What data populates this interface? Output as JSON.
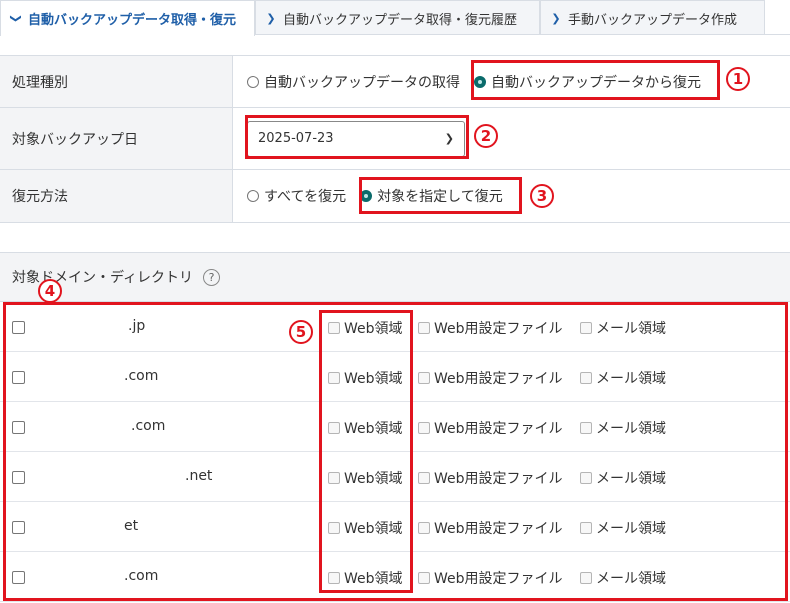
{
  "tabs": [
    {
      "label": "自動バックアップデータ取得・復元",
      "active": true
    },
    {
      "label": "自動バックアップデータ取得・復元履歴",
      "active": false
    },
    {
      "label": "手動バックアップデータ作成",
      "active": false
    }
  ],
  "settings": {
    "process_type": {
      "label": "処理種別",
      "options": [
        "自動バックアップデータの取得",
        "自動バックアップデータから復元"
      ],
      "selected": "自動バックアップデータから復元"
    },
    "backup_date": {
      "label": "対象バックアップ日",
      "value": "2025-07-23"
    },
    "restore_method": {
      "label": "復元方法",
      "options": [
        "すべてを復元",
        "対象を指定して復元"
      ],
      "selected": "対象を指定して復元"
    }
  },
  "domains": {
    "header": "対象ドメイン・ディレクトリ",
    "help_icon": "?",
    "option_labels": {
      "web": "Web領域",
      "web_config": "Web用設定ファイル",
      "mail": "メール領域"
    },
    "rows": [
      {
        "name": ".jp"
      },
      {
        "name": ".com"
      },
      {
        "name": ".com"
      },
      {
        "name": ".net"
      },
      {
        "name": "et"
      },
      {
        "name": ".com"
      }
    ]
  },
  "annotations": {
    "badges": [
      "1",
      "2",
      "3",
      "4",
      "5"
    ],
    "color": "#e1141e"
  },
  "colors": {
    "accent": "#1f5fa8",
    "radio_selected": "#0b6b6b"
  }
}
